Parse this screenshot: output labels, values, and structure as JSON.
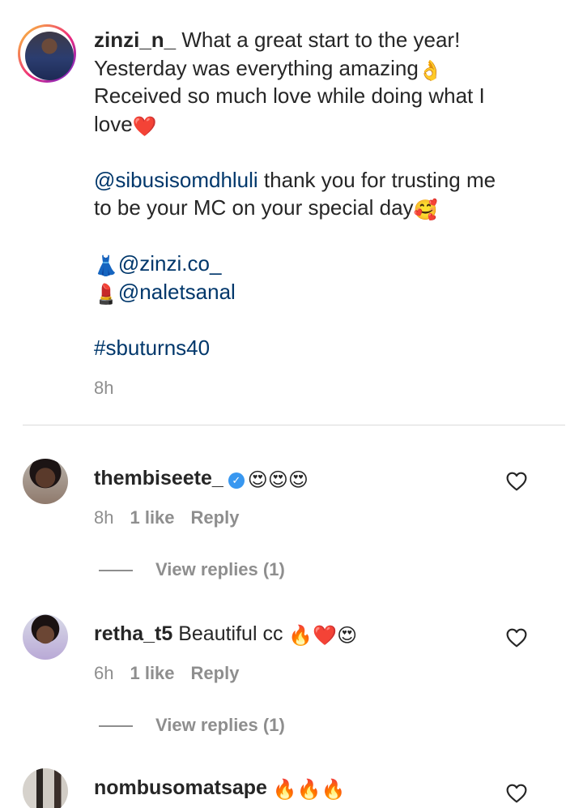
{
  "post": {
    "username": "zinzi_n_",
    "caption_line1": "What a great start to the year!",
    "caption_line2": "Yesterday was everything amazing",
    "emoji_ok": "👌",
    "caption_line3": "Received so much love while doing what I",
    "caption_line4": "love",
    "emoji_heart": "❤️",
    "mention1": "@sibusisomdhluli",
    "mention1_text": " thank you for trusting me",
    "mention1_line2": "to be your MC on your special day",
    "emoji_smiling_hearts": "🥰",
    "emoji_dress": "👗",
    "mention2": "@zinzi.co_",
    "emoji_lipstick": "💄",
    "mention3": "@naletsanal",
    "hashtag": "#sbuturns40",
    "time": "8h"
  },
  "comments": [
    {
      "username": "thembiseete_",
      "verified": true,
      "verified_glyph": "✓",
      "text": "",
      "emojis": "😍😍😍",
      "time": "8h",
      "likes": "1 like",
      "reply": "Reply",
      "view_replies": "View replies (1)"
    },
    {
      "username": "retha_t5",
      "verified": false,
      "text": "Beautiful cc ",
      "emojis": "🔥❤️😍",
      "time": "6h",
      "likes": "1 like",
      "reply": "Reply",
      "view_replies": "View replies (1)"
    },
    {
      "username": "nombusomatsape",
      "verified": false,
      "text": "",
      "emojis": "🔥🔥🔥"
    }
  ],
  "colors": {
    "link": "#00376b",
    "muted": "#8e8e8e",
    "text": "#262626",
    "verified": "#3897f0"
  },
  "icons": {
    "like": "heart-outline-icon",
    "verified": "verified-badge-icon"
  }
}
